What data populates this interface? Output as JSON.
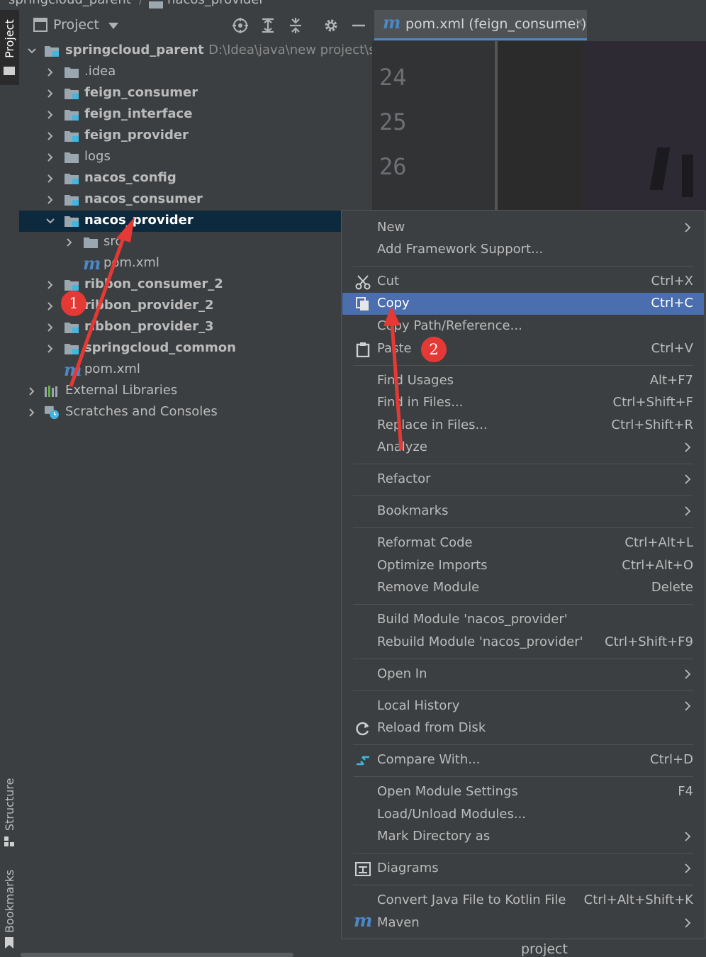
{
  "breadcrumb": {
    "root": "springcloud_parent",
    "module": "nacos_provider"
  },
  "left_strip": {
    "project_tab": "Project",
    "structure_tab": "Structure",
    "bookmarks_tab": "Bookmarks"
  },
  "project_panel": {
    "view_selector": "Project",
    "header_icons": [
      "locate-icon",
      "expand-all-icon",
      "collapse-all-icon",
      "gear-icon",
      "minimize-icon"
    ],
    "tree": [
      {
        "label": "springcloud_parent",
        "path": "D:\\Idea\\java\\new project\\spri",
        "bold": true,
        "expanded": true,
        "icon": "module-folder-icon"
      },
      {
        "label": ".idea",
        "bold": false,
        "expanded": false,
        "icon": "folder-icon"
      },
      {
        "label": "feign_consumer",
        "bold": true,
        "expanded": false,
        "icon": "module-folder-icon"
      },
      {
        "label": "feign_interface",
        "bold": true,
        "expanded": false,
        "icon": "module-folder-icon"
      },
      {
        "label": "feign_provider",
        "bold": true,
        "expanded": false,
        "icon": "module-folder-icon"
      },
      {
        "label": "logs",
        "bold": false,
        "expanded": false,
        "icon": "folder-icon"
      },
      {
        "label": "nacos_config",
        "bold": true,
        "expanded": false,
        "icon": "module-folder-icon"
      },
      {
        "label": "nacos_consumer",
        "bold": true,
        "expanded": false,
        "icon": "module-folder-icon"
      },
      {
        "label": "nacos_provider",
        "bold": true,
        "expanded": true,
        "selected": true,
        "icon": "module-folder-icon"
      },
      {
        "label": "src",
        "bold": false,
        "expanded": false,
        "icon": "folder-icon"
      },
      {
        "label": "pom.xml",
        "bold": false,
        "icon": "maven-icon"
      },
      {
        "label": "ribbon_consumer_2",
        "bold": true,
        "expanded": false,
        "icon": "module-folder-icon"
      },
      {
        "label": "ribbon_provider_2",
        "bold": true,
        "expanded": false,
        "icon": "module-folder-icon"
      },
      {
        "label": "ribbon_provider_3",
        "bold": true,
        "expanded": false,
        "icon": "module-folder-icon"
      },
      {
        "label": "springcloud_common",
        "bold": true,
        "expanded": false,
        "icon": "module-folder-icon"
      },
      {
        "label": "pom.xml",
        "bold": false,
        "icon": "maven-icon"
      },
      {
        "label": "External Libraries",
        "bold": false,
        "expanded": false,
        "icon": "libraries-icon"
      },
      {
        "label": "Scratches and Consoles",
        "bold": false,
        "expanded": false,
        "icon": "scratches-icon"
      }
    ]
  },
  "editor": {
    "tab_label": "pom.xml (feign_consumer)",
    "line_numbers": [
      "24",
      "25",
      "26"
    ]
  },
  "context_menu": {
    "items": [
      {
        "label": "New",
        "submenu": true
      },
      {
        "label": "Add Framework Support..."
      },
      {
        "label": "Cut",
        "shortcut": "Ctrl+X",
        "icon": "scissors-icon"
      },
      {
        "label": "Copy",
        "shortcut": "Ctrl+C",
        "icon": "copy-icon",
        "highlighted": true
      },
      {
        "label": "Copy Path/Reference..."
      },
      {
        "label": "Paste",
        "shortcut": "Ctrl+V",
        "icon": "clipboard-icon"
      },
      {
        "label": "Find Usages",
        "shortcut": "Alt+F7"
      },
      {
        "label": "Find in Files...",
        "shortcut": "Ctrl+Shift+F"
      },
      {
        "label": "Replace in Files...",
        "shortcut": "Ctrl+Shift+R"
      },
      {
        "label": "Analyze",
        "submenu": true
      },
      {
        "label": "Refactor",
        "submenu": true
      },
      {
        "label": "Bookmarks",
        "submenu": true
      },
      {
        "label": "Reformat Code",
        "shortcut": "Ctrl+Alt+L"
      },
      {
        "label": "Optimize Imports",
        "shortcut": "Ctrl+Alt+O"
      },
      {
        "label": "Remove Module",
        "shortcut": "Delete"
      },
      {
        "label": "Build Module 'nacos_provider'"
      },
      {
        "label": "Rebuild Module 'nacos_provider'",
        "shortcut": "Ctrl+Shift+F9"
      },
      {
        "label": "Open In",
        "submenu": true
      },
      {
        "label": "Local History",
        "submenu": true
      },
      {
        "label": "Reload from Disk",
        "icon": "reload-icon"
      },
      {
        "label": "Compare With...",
        "shortcut": "Ctrl+D",
        "icon": "compare-icon"
      },
      {
        "label": "Open Module Settings",
        "shortcut": "F4"
      },
      {
        "label": "Load/Unload Modules..."
      },
      {
        "label": "Mark Directory as",
        "submenu": true
      },
      {
        "label": "Diagrams",
        "submenu": true,
        "icon": "diagrams-icon"
      },
      {
        "label": "Convert Java File to Kotlin File",
        "shortcut": "Ctrl+Alt+Shift+K"
      },
      {
        "label": "Maven",
        "submenu": true,
        "icon": "maven-icon"
      }
    ]
  },
  "bottom_bar": {
    "label": "project"
  },
  "annotations": {
    "step1": "1",
    "step2": "2"
  },
  "colors": {
    "selection": "#0d293e",
    "menu_highlight": "#4b6eaf",
    "accent": "#4a88c7",
    "annotation": "#e53935"
  }
}
